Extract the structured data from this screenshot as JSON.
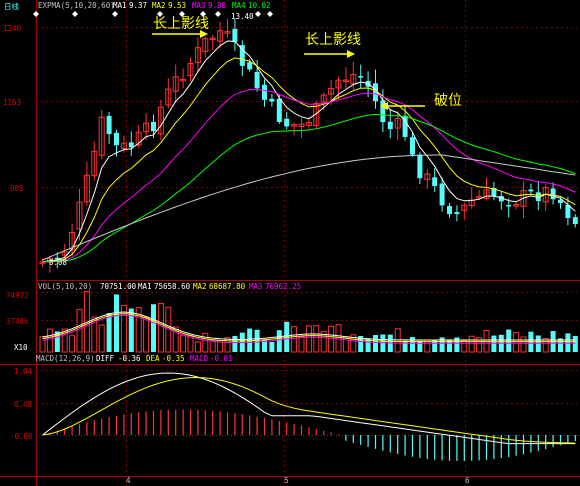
{
  "main_panel": {
    "period_label": "日线",
    "indicator_prefix": "EXPMA(5,10,20,60)",
    "ma_values": [
      {
        "label": "MA1",
        "value": "9.37",
        "color": "#ffffff"
      },
      {
        "label": "MA2",
        "value": "9.53",
        "color": "#ffff00"
      },
      {
        "label": "MA3",
        "value": "9.80",
        "color": "#ff00ff"
      },
      {
        "label": "MA4",
        "value": "10.02",
        "color": "#00ff00"
      }
    ],
    "y_ticks": [
      "1340",
      "1163",
      "985"
    ],
    "high_label": "13.40",
    "low_label": "8.08",
    "annotations": {
      "shadow1": "长上影线",
      "shadow2": "长上影线",
      "breakdown": "破位"
    }
  },
  "volume_panel": {
    "prefix": "VOL(5,10,20)",
    "values": [
      {
        "label": "",
        "value": "70751.00",
        "color": "#ffffff"
      },
      {
        "label": "MA1",
        "value": "75658.60",
        "color": "#ffffff"
      },
      {
        "label": "MA2",
        "value": "68687.80",
        "color": "#ffff00"
      },
      {
        "label": "MA3",
        "value": "76962.25",
        "color": "#ff00ff"
      }
    ],
    "y_ticks": [
      "74972",
      "37486"
    ],
    "unit": "X10"
  },
  "macd_panel": {
    "prefix": "MACD(12,26,9)",
    "values": [
      {
        "label": "DIFF",
        "value": "-0.36",
        "color": "#ffffff"
      },
      {
        "label": "DEA",
        "value": "-0.35",
        "color": "#ffff00"
      },
      {
        "label": "MACD",
        "value": "-0.01",
        "color": "#ff00ff"
      }
    ],
    "y_ticks": [
      "1.04",
      "0.49",
      "-0.06"
    ]
  },
  "x_axis": {
    "months": [
      "4",
      "5",
      "6"
    ]
  },
  "colors": {
    "up": "#ff3333",
    "down": "#54fcfc",
    "grid": "#800000",
    "axis_text": "#e00000"
  }
}
